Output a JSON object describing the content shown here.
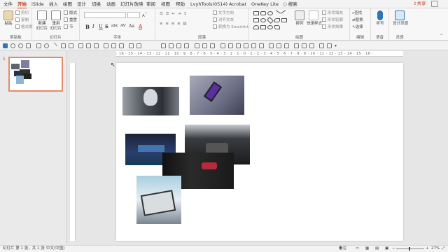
{
  "tabs": {
    "file": "文件",
    "home": "开始",
    "islide": "iSlide",
    "insert": "插入",
    "draw": "绘图",
    "design": "设计",
    "transitions": "切换",
    "animations": "动画",
    "slideshow": "幻灯片放映",
    "review": "审阅",
    "view": "视图",
    "help": "帮助",
    "lvyhtools": "LvyhTools(0514)",
    "acrobat": "Acrobat",
    "onekey": "OneKey Lite",
    "search": "搜索",
    "share": "共享"
  },
  "ribbon": {
    "clipboard": {
      "label": "剪贴板",
      "paste": "粘贴",
      "cut": "剪切",
      "copy": "复制",
      "format_painter": "格式刷"
    },
    "slides": {
      "label": "幻灯片",
      "new_slide": "新建",
      "new_slide_2": "幻灯片",
      "reuse": "重用",
      "reuse_2": "幻灯片",
      "layout": "版式",
      "reset": "重置",
      "section": "节"
    },
    "font": {
      "label": "字体",
      "bold": "B",
      "italic": "I",
      "underline": "U",
      "strike": "S",
      "shadow": "abc",
      "spacing": "AV",
      "case": "Aa",
      "color": "A"
    },
    "paragraph": {
      "label": "段落",
      "text_direction": "文字方向",
      "align_text": "对齐文本",
      "smartart": "转换为 SmartArt"
    },
    "drawing": {
      "label": "绘图",
      "arrange": "排列",
      "quick_styles": "快速样式",
      "shape_fill": "形状填充",
      "shape_outline": "形状轮廓",
      "shape_effects": "形状效果"
    },
    "editing": {
      "label": "编辑",
      "find": "查找",
      "replace": "替换",
      "select": "选择"
    },
    "voice": {
      "label": "语音",
      "dictate": "听写"
    },
    "designer": {
      "label": "灵感",
      "ideas": "设计灵感"
    }
  },
  "ruler": {
    "h_ticks": "· 16 · 15 · 14 · 13 · 12 · 11 · 10 · 9 · 8 · 7 · 6 · 5 · 4 · 3 · 2 · 1 · 0 · 1 · 2 · 3 · 4 · 5 · 6 · 7 · 8 · 9 · 10 · 11 · 12 · 13 · 14 · 15 · 16 ·"
  },
  "thumbnails": [
    {
      "number": "1"
    }
  ],
  "statusbar": {
    "slide_info": "幻灯片 第 1 张，共 1 张",
    "language": "中文(中国)",
    "notes": "备注",
    "zoom": "27%"
  },
  "colors": {
    "accent": "#c43e1c",
    "ribbon_bg": "#f7f7f7",
    "canvas_bg": "#e6e6e6"
  }
}
